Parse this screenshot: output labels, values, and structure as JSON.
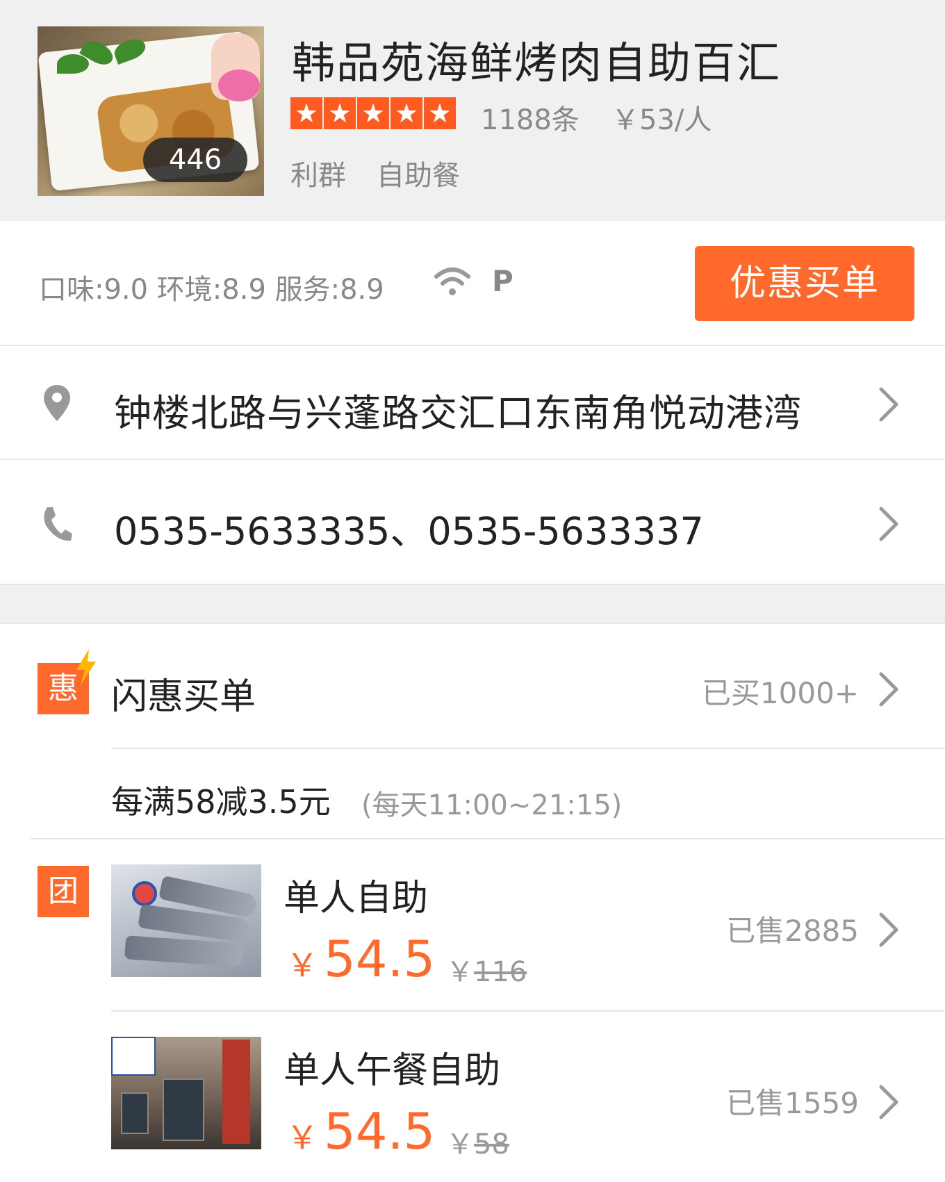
{
  "shop": {
    "name": "韩品苑海鲜烤肉自助百汇",
    "photo_count": "446",
    "rating_stars": 5,
    "review_count": "1188条",
    "avg_price": "￥53/人",
    "area": "利群",
    "category": "自助餐"
  },
  "scores": {
    "text": "口味:9.0 环境:8.9 服务:8.9",
    "wifi_icon": "wifi-icon",
    "parking": "P"
  },
  "pay_button": "优惠买单",
  "address": "钟楼北路与兴蓬路交汇口东南角悦动港湾",
  "phone": "0535-5633335、0535-5633337",
  "flash_deal": {
    "badge": "惠",
    "title": "闪惠买单",
    "sold": "已买1000+",
    "rule": "每满58减3.5元",
    "time": "(每天11:00~21:15)"
  },
  "group_badge": "团",
  "deals": [
    {
      "title": "单人自助",
      "yen": "￥",
      "price": "54.5",
      "orig_yen": "￥",
      "orig_price": "116",
      "sold": "已售2885"
    },
    {
      "title": "单人午餐自助",
      "yen": "￥",
      "price": "54.5",
      "orig_yen": "￥",
      "orig_price": "58",
      "sold": "已售1559"
    }
  ],
  "colors": {
    "accent": "#ff6a2c",
    "background_gray": "#f0f0f0",
    "muted_text": "#888888"
  }
}
